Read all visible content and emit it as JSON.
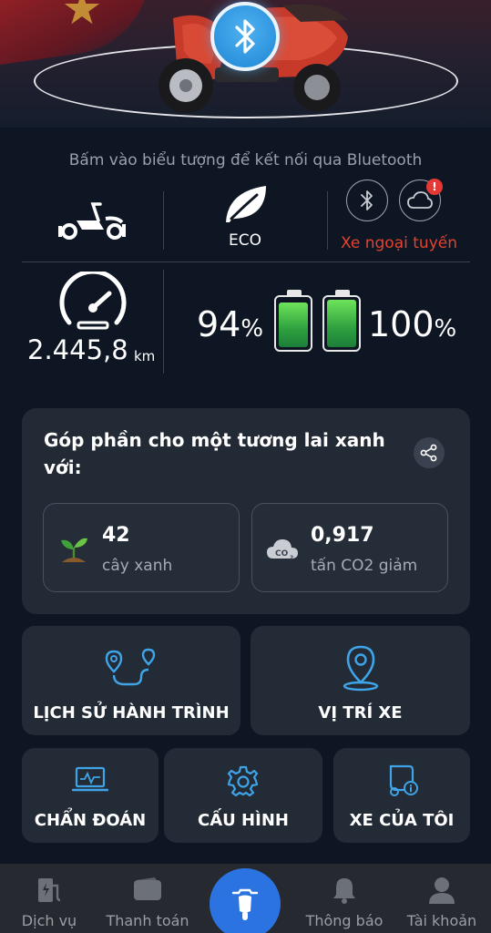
{
  "hint_text": "Bấm vào biểu tượng để kết nối qua Bluetooth",
  "status": {
    "mode": "ECO",
    "connection": "Xe ngoại tuyến",
    "alert_badge": "!",
    "colors": {
      "offline": "#e4432f",
      "alert": "#e53935"
    }
  },
  "odometer": {
    "value": "2.445,8",
    "unit": "km"
  },
  "batteries": [
    {
      "percent_value": "94",
      "percent_sign": "%",
      "level": 0.94
    },
    {
      "percent_value": "100",
      "percent_sign": "%",
      "level": 1.0
    }
  ],
  "green_card": {
    "title": "Góp phần cho một tương lai xanh với:",
    "stats": [
      {
        "value": "42",
        "label": "cây xanh",
        "icon": "sprout-icon"
      },
      {
        "value": "0,917",
        "label": "tấn CO2 giảm",
        "icon": "co2-cloud-icon"
      }
    ]
  },
  "actions": {
    "trip_history": "LỊCH SỬ HÀNH TRÌNH",
    "vehicle_location": "VỊ TRÍ XE",
    "diagnostics": "CHẨN ĐOÁN",
    "configuration": "CẤU HÌNH",
    "my_vehicle": "XE CỦA TÔI"
  },
  "nav": {
    "services": "Dịch vụ",
    "payment": "Thanh toán",
    "notifications": "Thông báo",
    "account": "Tài khoản"
  },
  "accent_color": "#2b73e0"
}
